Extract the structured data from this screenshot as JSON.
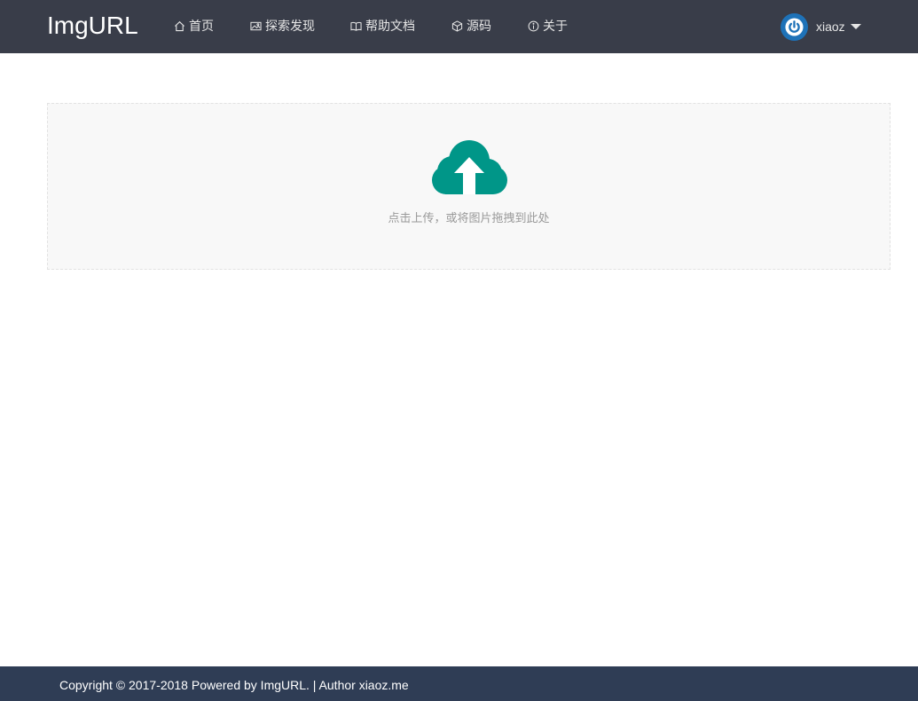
{
  "brand": "ImgURL",
  "nav": {
    "items": [
      {
        "label": "首页",
        "icon": "home-icon"
      },
      {
        "label": "探索发现",
        "icon": "image-icon"
      },
      {
        "label": "帮助文档",
        "icon": "book-icon"
      },
      {
        "label": "源码",
        "icon": "cube-icon"
      },
      {
        "label": "关于",
        "icon": "info-icon"
      }
    ]
  },
  "user": {
    "name": "xiaoz",
    "avatar_icon": "power-icon",
    "avatar_color": "#1e72b8"
  },
  "upload": {
    "icon": "cloud-upload-icon",
    "icon_color": "#009688",
    "hint": "点击上传，或将图片拖拽到此处"
  },
  "footer": {
    "text": "Copyright © 2017-2018 Powered by ImgURL. | Author xiaoz.me"
  },
  "colors": {
    "navbar_bg": "#393d49",
    "footer_bg": "#2f3d55",
    "upload_bg": "#f8f8f8"
  }
}
